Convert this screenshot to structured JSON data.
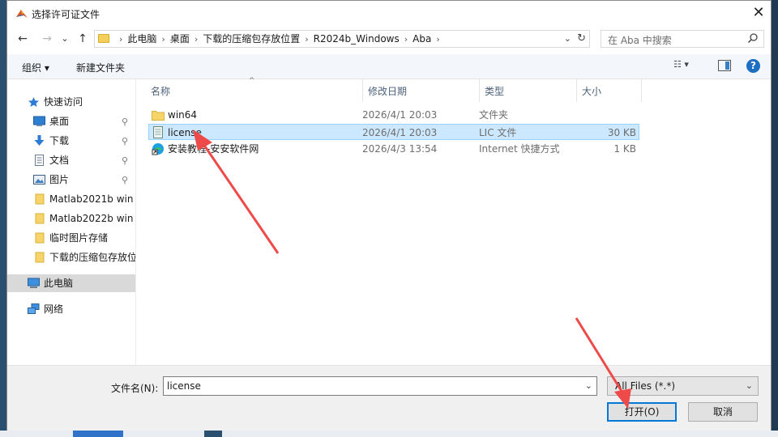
{
  "window": {
    "title": "选择许可证文件",
    "close_glyph": "✕"
  },
  "nav": {
    "back_glyph": "←",
    "forward_glyph": "→",
    "recent_glyph": "⌄",
    "up_glyph": "↑",
    "breadcrumbs": [
      "此电脑",
      "桌面",
      "下载的压缩包存放位置",
      "R2024b_Windows",
      "Aba"
    ],
    "crumb_sep": "›",
    "dropdown_glyph": "⌄",
    "refresh_glyph": "↻",
    "search_placeholder": "在 Aba 中搜索"
  },
  "toolbar": {
    "organize": "组织 ▾",
    "new_folder": "新建文件夹",
    "view_glyph": "☷ ▾",
    "help": "?"
  },
  "sidebar": {
    "items": [
      {
        "label": "快速访问",
        "icon": "star-icon",
        "pinned": false
      },
      {
        "label": "桌面",
        "icon": "desktop-icon",
        "pinned": true
      },
      {
        "label": "下载",
        "icon": "download-icon",
        "pinned": true
      },
      {
        "label": "文档",
        "icon": "document-icon",
        "pinned": true
      },
      {
        "label": "图片",
        "icon": "picture-icon",
        "pinned": true
      },
      {
        "label": "Matlab2021b win",
        "icon": "folder-icon",
        "pinned": false
      },
      {
        "label": "Matlab2022b win",
        "icon": "folder-icon",
        "pinned": false
      },
      {
        "label": "临时图片存储",
        "icon": "folder-icon",
        "pinned": false
      },
      {
        "label": "下载的压缩包存放位",
        "icon": "folder-icon",
        "pinned": false
      },
      {
        "label": "此电脑",
        "icon": "computer-icon",
        "pinned": false
      },
      {
        "label": "网络",
        "icon": "network-icon",
        "pinned": false
      }
    ],
    "pin_glyph": "📌"
  },
  "columns": {
    "name": "名称",
    "date": "修改日期",
    "type": "类型",
    "size": "大小",
    "sort_glyph": "^"
  },
  "files": [
    {
      "name": "win64",
      "date": "2026/4/1 20:03",
      "type": "文件夹",
      "size": "",
      "icon": "folder-icon"
    },
    {
      "name": "license",
      "date": "2026/4/1 20:03",
      "type": "LIC 文件",
      "size": "30 KB",
      "icon": "file-icon"
    },
    {
      "name": "安装教程-安安软件网",
      "date": "2026/4/3 13:54",
      "type": "Internet 快捷方式",
      "size": "1 KB",
      "icon": "internet-shortcut-icon"
    }
  ],
  "bottom": {
    "filename_label": "文件名(N):",
    "filename_value": "license",
    "filetype_value": "All Files (*.*)",
    "dropdown_glyph": "⌄",
    "open_button": "打开(O)",
    "cancel_button": "取消"
  },
  "colors": {
    "selection": "#cce8ff",
    "annotation_arrow": "#ef4a4a",
    "primary_border": "#0078d7"
  }
}
